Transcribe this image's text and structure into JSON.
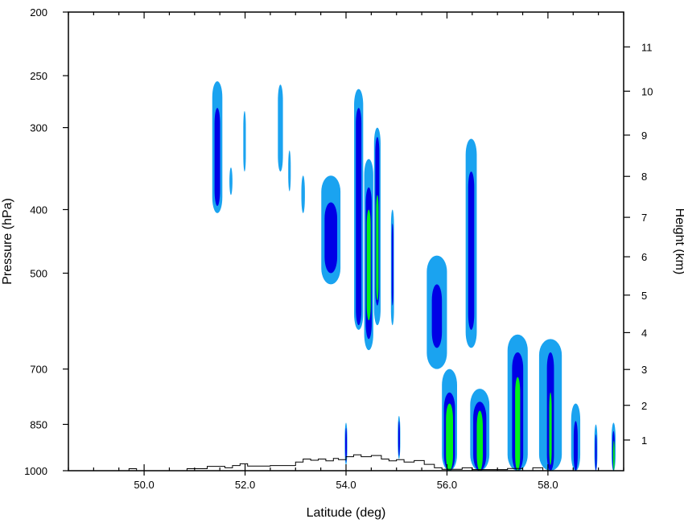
{
  "chart_data": {
    "type": "heatmap",
    "title": "",
    "xlabel": "Latitude (deg)",
    "ylabel": "Pressure (hPa)",
    "y2label": "Height (km)",
    "xlim": [
      48.5,
      59.5
    ],
    "ylim": [
      1000,
      200
    ],
    "y_scale": "log-pressure",
    "x_ticks": [
      {
        "value": 50,
        "label": "50.0"
      },
      {
        "value": 52,
        "label": "52.0"
      },
      {
        "value": 54,
        "label": "54.0"
      },
      {
        "value": 56,
        "label": "56.0"
      },
      {
        "value": 58,
        "label": "58.0"
      }
    ],
    "y_ticks": [
      {
        "value": 1000,
        "label": "1000"
      },
      {
        "value": 850,
        "label": "850"
      },
      {
        "value": 700,
        "label": "700"
      },
      {
        "value": 500,
        "label": "500"
      },
      {
        "value": 400,
        "label": "400"
      },
      {
        "value": 300,
        "label": "300"
      },
      {
        "value": 250,
        "label": "250"
      },
      {
        "value": 200,
        "label": "200"
      }
    ],
    "y2_ticks": [
      {
        "value": 1,
        "pressure": 898,
        "label": "1"
      },
      {
        "value": 2,
        "pressure": 795,
        "label": "2"
      },
      {
        "value": 3,
        "pressure": 701,
        "label": "3"
      },
      {
        "value": 4,
        "pressure": 616,
        "label": "4"
      },
      {
        "value": 5,
        "pressure": 540,
        "label": "5"
      },
      {
        "value": 6,
        "pressure": 472,
        "label": "6"
      },
      {
        "value": 7,
        "pressure": 411,
        "label": "7"
      },
      {
        "value": 8,
        "pressure": 356,
        "label": "8"
      },
      {
        "value": 9,
        "pressure": 308,
        "label": "9"
      },
      {
        "value": 10,
        "pressure": 264,
        "label": "10"
      },
      {
        "value": 11,
        "pressure": 226,
        "label": "11"
      }
    ],
    "levels": [
      {
        "name": "light",
        "color": "#1aa3f0"
      },
      {
        "name": "medium",
        "color": "#0000e6"
      },
      {
        "name": "heavy",
        "color": "#00f21a"
      }
    ],
    "cells": [
      {
        "lat": 51.45,
        "p_top": 255,
        "p_bot": 405,
        "w": 0.18,
        "levels": [
          {
            "p_top": 255,
            "p_bot": 405,
            "w": 0.2
          },
          {
            "p_top": 280,
            "p_bot": 395,
            "w": 0.11
          }
        ]
      },
      {
        "lat": 51.72,
        "p_top": 345,
        "p_bot": 380,
        "w": 0.06,
        "levels": [
          {
            "p_top": 345,
            "p_bot": 380,
            "w": 0.06
          }
        ]
      },
      {
        "lat": 51.99,
        "p_top": 283,
        "p_bot": 350,
        "w": 0.05,
        "levels": [
          {
            "p_top": 283,
            "p_bot": 350,
            "w": 0.05
          }
        ]
      },
      {
        "lat": 52.7,
        "p_top": 258,
        "p_bot": 350,
        "w": 0.11,
        "levels": [
          {
            "p_top": 258,
            "p_bot": 350,
            "w": 0.1
          }
        ]
      },
      {
        "lat": 52.88,
        "p_top": 325,
        "p_bot": 375,
        "w": 0.05,
        "levels": [
          {
            "p_top": 325,
            "p_bot": 375,
            "w": 0.05
          }
        ]
      },
      {
        "lat": 53.15,
        "p_top": 355,
        "p_bot": 405,
        "w": 0.07,
        "levels": [
          {
            "p_top": 355,
            "p_bot": 405,
            "w": 0.07
          }
        ]
      },
      {
        "lat": 53.7,
        "p_top": 355,
        "p_bot": 520,
        "w": 0.38,
        "levels": [
          {
            "p_top": 355,
            "p_bot": 520,
            "w": 0.38
          },
          {
            "p_top": 390,
            "p_bot": 500,
            "w": 0.25
          }
        ]
      },
      {
        "lat": 54.25,
        "p_top": 262,
        "p_bot": 610,
        "w": 0.18,
        "levels": [
          {
            "p_top": 262,
            "p_bot": 610,
            "w": 0.18
          },
          {
            "p_top": 280,
            "p_bot": 600,
            "w": 0.11
          }
        ]
      },
      {
        "lat": 54.45,
        "p_top": 335,
        "p_bot": 655,
        "w": 0.18,
        "levels": [
          {
            "p_top": 335,
            "p_bot": 655,
            "w": 0.18
          },
          {
            "p_top": 370,
            "p_bot": 630,
            "w": 0.12
          },
          {
            "p_top": 400,
            "p_bot": 590,
            "w": 0.08
          }
        ]
      },
      {
        "lat": 54.62,
        "p_top": 300,
        "p_bot": 600,
        "w": 0.14,
        "levels": [
          {
            "p_top": 300,
            "p_bot": 600,
            "w": 0.13
          },
          {
            "p_top": 310,
            "p_bot": 560,
            "w": 0.08
          },
          {
            "p_top": 380,
            "p_bot": 550,
            "w": 0.05
          }
        ]
      },
      {
        "lat": 54.92,
        "p_top": 400,
        "p_bot": 600,
        "w": 0.06,
        "levels": [
          {
            "p_top": 400,
            "p_bot": 600,
            "w": 0.06
          },
          {
            "p_top": 420,
            "p_bot": 560,
            "w": 0.03
          }
        ]
      },
      {
        "lat": 55.8,
        "p_top": 470,
        "p_bot": 700,
        "w": 0.4,
        "levels": [
          {
            "p_top": 470,
            "p_bot": 700,
            "w": 0.4
          },
          {
            "p_top": 520,
            "p_bot": 650,
            "w": 0.2
          }
        ]
      },
      {
        "lat": 56.48,
        "p_top": 312,
        "p_bot": 650,
        "w": 0.22,
        "levels": [
          {
            "p_top": 312,
            "p_bot": 650,
            "w": 0.22
          },
          {
            "p_top": 350,
            "p_bot": 610,
            "w": 0.12
          }
        ]
      },
      {
        "lat": 54.0,
        "p_top": 845,
        "p_bot": 980,
        "w": 0.05,
        "levels": [
          {
            "p_top": 845,
            "p_bot": 980,
            "w": 0.05
          },
          {
            "p_top": 860,
            "p_bot": 970,
            "w": 0.03
          }
        ]
      },
      {
        "lat": 55.05,
        "p_top": 825,
        "p_bot": 960,
        "w": 0.05,
        "levels": [
          {
            "p_top": 825,
            "p_bot": 960,
            "w": 0.05
          },
          {
            "p_top": 840,
            "p_bot": 950,
            "w": 0.03
          }
        ]
      },
      {
        "lat": 56.05,
        "p_top": 700,
        "p_bot": 1000,
        "w": 0.3,
        "levels": [
          {
            "p_top": 700,
            "p_bot": 1000,
            "w": 0.3
          },
          {
            "p_top": 760,
            "p_bot": 1000,
            "w": 0.22
          },
          {
            "p_top": 790,
            "p_bot": 1000,
            "w": 0.14
          }
        ]
      },
      {
        "lat": 56.65,
        "p_top": 750,
        "p_bot": 1000,
        "w": 0.38,
        "levels": [
          {
            "p_top": 750,
            "p_bot": 1000,
            "w": 0.38
          },
          {
            "p_top": 785,
            "p_bot": 1000,
            "w": 0.26
          },
          {
            "p_top": 810,
            "p_bot": 1000,
            "w": 0.12
          }
        ]
      },
      {
        "lat": 57.4,
        "p_top": 620,
        "p_bot": 1000,
        "w": 0.4,
        "levels": [
          {
            "p_top": 620,
            "p_bot": 1000,
            "w": 0.4
          },
          {
            "p_top": 660,
            "p_bot": 1000,
            "w": 0.22
          },
          {
            "p_top": 720,
            "p_bot": 1000,
            "w": 0.1
          }
        ]
      },
      {
        "lat": 58.05,
        "p_top": 630,
        "p_bot": 1000,
        "w": 0.45,
        "levels": [
          {
            "p_top": 630,
            "p_bot": 1000,
            "w": 0.45
          },
          {
            "p_top": 660,
            "p_bot": 1000,
            "w": 0.14
          },
          {
            "p_top": 760,
            "p_bot": 980,
            "w": 0.05
          }
        ]
      },
      {
        "lat": 58.55,
        "p_top": 790,
        "p_bot": 1000,
        "w": 0.18,
        "levels": [
          {
            "p_top": 790,
            "p_bot": 1000,
            "w": 0.18
          },
          {
            "p_top": 840,
            "p_bot": 1000,
            "w": 0.08
          }
        ]
      },
      {
        "lat": 58.95,
        "p_top": 850,
        "p_bot": 1000,
        "w": 0.06,
        "levels": [
          {
            "p_top": 850,
            "p_bot": 1000,
            "w": 0.06
          },
          {
            "p_top": 880,
            "p_bot": 1000,
            "w": 0.03
          }
        ]
      },
      {
        "lat": 59.3,
        "p_top": 845,
        "p_bot": 1000,
        "w": 0.08,
        "levels": [
          {
            "p_top": 845,
            "p_bot": 1000,
            "w": 0.08
          },
          {
            "p_top": 870,
            "p_bot": 1000,
            "w": 0.05
          },
          {
            "p_top": 900,
            "p_bot": 1000,
            "w": 0.02
          }
        ]
      }
    ],
    "terrain": [
      [
        48.5,
        1000
      ],
      [
        49.7,
        1000
      ],
      [
        49.7,
        993
      ],
      [
        49.85,
        993
      ],
      [
        49.85,
        1000
      ],
      [
        50.85,
        1000
      ],
      [
        50.85,
        993
      ],
      [
        51.25,
        993
      ],
      [
        51.25,
        985
      ],
      [
        51.6,
        985
      ],
      [
        51.6,
        990
      ],
      [
        51.75,
        990
      ],
      [
        51.75,
        982
      ],
      [
        51.9,
        982
      ],
      [
        51.9,
        976
      ],
      [
        52.05,
        976
      ],
      [
        52.05,
        984
      ],
      [
        52.5,
        984
      ],
      [
        52.5,
        982
      ],
      [
        53.0,
        982
      ],
      [
        53.0,
        970
      ],
      [
        53.15,
        970
      ],
      [
        53.15,
        960
      ],
      [
        53.3,
        960
      ],
      [
        53.3,
        964
      ],
      [
        53.45,
        964
      ],
      [
        53.45,
        960
      ],
      [
        53.6,
        960
      ],
      [
        53.6,
        966
      ],
      [
        53.75,
        966
      ],
      [
        53.75,
        958
      ],
      [
        53.85,
        958
      ],
      [
        53.85,
        962
      ],
      [
        54.0,
        962
      ],
      [
        54.0,
        952
      ],
      [
        54.15,
        952
      ],
      [
        54.15,
        946
      ],
      [
        54.3,
        946
      ],
      [
        54.3,
        952
      ],
      [
        54.5,
        952
      ],
      [
        54.5,
        948
      ],
      [
        54.7,
        948
      ],
      [
        54.7,
        960
      ],
      [
        54.85,
        960
      ],
      [
        54.85,
        966
      ],
      [
        55.0,
        966
      ],
      [
        55.0,
        962
      ],
      [
        55.15,
        962
      ],
      [
        55.15,
        970
      ],
      [
        55.35,
        970
      ],
      [
        55.35,
        965
      ],
      [
        55.55,
        965
      ],
      [
        55.55,
        978
      ],
      [
        55.75,
        978
      ],
      [
        55.75,
        990
      ],
      [
        55.9,
        990
      ],
      [
        55.9,
        995
      ],
      [
        56.3,
        995
      ],
      [
        56.3,
        990
      ],
      [
        56.5,
        990
      ],
      [
        56.5,
        996
      ],
      [
        57.2,
        996
      ],
      [
        57.2,
        992
      ],
      [
        57.5,
        992
      ],
      [
        57.5,
        1000
      ],
      [
        57.7,
        1000
      ],
      [
        57.7,
        990
      ],
      [
        57.9,
        990
      ],
      [
        57.9,
        1000
      ],
      [
        59.5,
        1000
      ]
    ]
  }
}
